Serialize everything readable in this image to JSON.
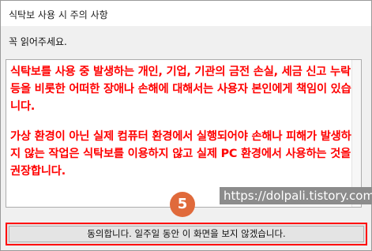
{
  "window": {
    "title": "식탁보 사용 시 주의 사항"
  },
  "subtitle": "꼭 읽어주세요.",
  "notice": {
    "paragraph1": "식탁보를 사용 중 발생하는 개인, 기업, 기관의 금전 손실, 세금 신고 누락 등을 비롯한 어떠한 장애나 손해에 대해서는 사용자 본인에게 책임이 있습니다.",
    "paragraph2": "가상 환경이 아닌 실제 컴퓨터 환경에서 실행되어야 손해나 피해가 발생하지 않는 작업은 식탁보를 이용하지 않고 실제 PC 환경에서 사용하는 것을 권장합니다.",
    "text_color": "#ff0000"
  },
  "watermark": "https://dolpali.tistory.com",
  "step_badge": "5",
  "agree_button": {
    "label": "동의합니다. 일주일 동안 이 화면을 보지 않겠습니다."
  },
  "colors": {
    "highlight": "#ff0000",
    "badge": "#e06a3b"
  }
}
